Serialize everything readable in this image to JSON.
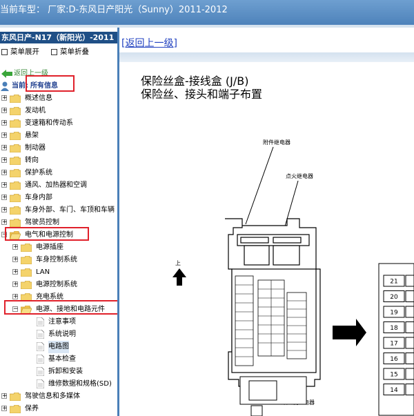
{
  "header": {
    "title": "当前车型：  厂家:D-东风日产阳光（Sunny）2011-2012"
  },
  "sidebar": {
    "title": "东风日产-N17（新阳光）-2011",
    "expand_label": "菜单展开",
    "collapse_label": "菜单折叠",
    "back_label": "返回上一级",
    "current_prefix": "当前:",
    "current_value": "所有信息",
    "items": [
      "概述信息",
      "发动机",
      "变速箱和传动系",
      "悬架",
      "制动器",
      "转向",
      "保护系统",
      "通风、加热器和空调",
      "车身内部",
      "车身外部、车门、车顶和车辆",
      "驾驶员控制",
      "电气和电源控制"
    ],
    "sub_items": [
      "电源插座",
      "车身控制系统",
      "LAN",
      "电源控制系统",
      "充电系统",
      "电源、接地和电路元件"
    ],
    "leaf_items": [
      "注意事项",
      "系统说明",
      "电路图",
      "基本检查",
      "拆卸和安装",
      "维修数据和规格(SD)"
    ],
    "tail_items": [
      "驾驶信息和多媒体",
      "保养"
    ]
  },
  "main": {
    "back_link": "[返回上一级]",
    "diagram": {
      "title1": "保险丝盒-接线盒 (J/B)",
      "title2": "保险丝、接头和端子布置",
      "label_accessory_relay": "附件继电器",
      "label_ignition_relay": "点火继电器",
      "label_blower_relay": "鼓风机继电器",
      "up_label": "上",
      "fuse_numbers": [
        "21",
        "20",
        "19",
        "18",
        "17",
        "16",
        "15",
        "14"
      ]
    }
  },
  "colors": {
    "accent": "#4a7fb8",
    "title_bar": "#1f4f86",
    "highlight": "#e0202a",
    "link": "#2040c0"
  }
}
